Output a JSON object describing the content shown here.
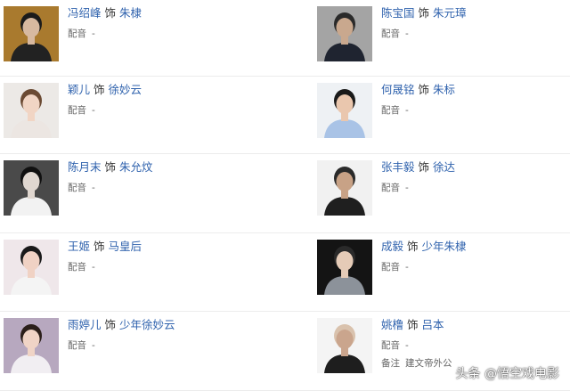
{
  "shi_label": "饰",
  "dubbing_label": "配音",
  "cast": [
    {
      "left": {
        "actor": "冯绍峰",
        "role": "朱棣",
        "dubbing": "-",
        "bg": "#a97a2e",
        "skin": "#d7b9a0",
        "hair": "#1b1b1b",
        "cloth": "#222222"
      },
      "right": {
        "actor": "陈宝国",
        "role": "朱元璋",
        "dubbing": "-",
        "bg": "#a4a4a4",
        "skin": "#c9a88e",
        "hair": "#2a2a2a",
        "cloth": "#1f2430"
      }
    },
    {
      "left": {
        "actor": "颖儿",
        "role": "徐妙云",
        "dubbing": "-",
        "bg": "#ece9e6",
        "skin": "#f1d5c4",
        "hair": "#6b4a33",
        "cloth": "#ece6e2"
      },
      "right": {
        "actor": "何晟铭",
        "role": "朱标",
        "dubbing": "-",
        "bg": "#eef1f4",
        "skin": "#eac7ae",
        "hair": "#1a1a1a",
        "cloth": "#a9c3e6"
      }
    },
    {
      "left": {
        "actor": "陈月末",
        "role": "朱允炆",
        "dubbing": "-",
        "bg": "#4a4a4a",
        "skin": "#e0d7d0",
        "hair": "#101010",
        "cloth": "#f2f2f2"
      },
      "right": {
        "actor": "张丰毅",
        "role": "徐达",
        "dubbing": "-",
        "bg": "#f1f1f1",
        "skin": "#c8a286",
        "hair": "#2a2a2a",
        "cloth": "#1f1f1f"
      }
    },
    {
      "left": {
        "actor": "王姬",
        "role": "马皇后",
        "dubbing": "-",
        "bg": "#efe7ea",
        "skin": "#f0d2c4",
        "hair": "#1a1a1a",
        "cloth": "#f4f4f4"
      },
      "right": {
        "actor": "成毅",
        "role": "少年朱棣",
        "dubbing": "-",
        "bg": "#141414",
        "skin": "#e5cbb7",
        "hair": "#2a2a2a",
        "cloth": "#8c929a"
      }
    },
    {
      "left": {
        "actor": "雨婷儿",
        "role": "少年徐妙云",
        "dubbing": "-",
        "bg": "#b7a8bf",
        "skin": "#f0d4c6",
        "hair": "#2b1f1a",
        "cloth": "#f1eef2"
      },
      "right": {
        "actor": "姚橹",
        "role": "吕本",
        "dubbing": "-",
        "bg": "#f4f4f4",
        "skin": "#caa58d",
        "hair": "#d9c2ad",
        "cloth": "#1e1e1e",
        "note_label": "备注",
        "note": "建文帝外公"
      }
    }
  ],
  "watermark": "头条 @悟空戏电影"
}
